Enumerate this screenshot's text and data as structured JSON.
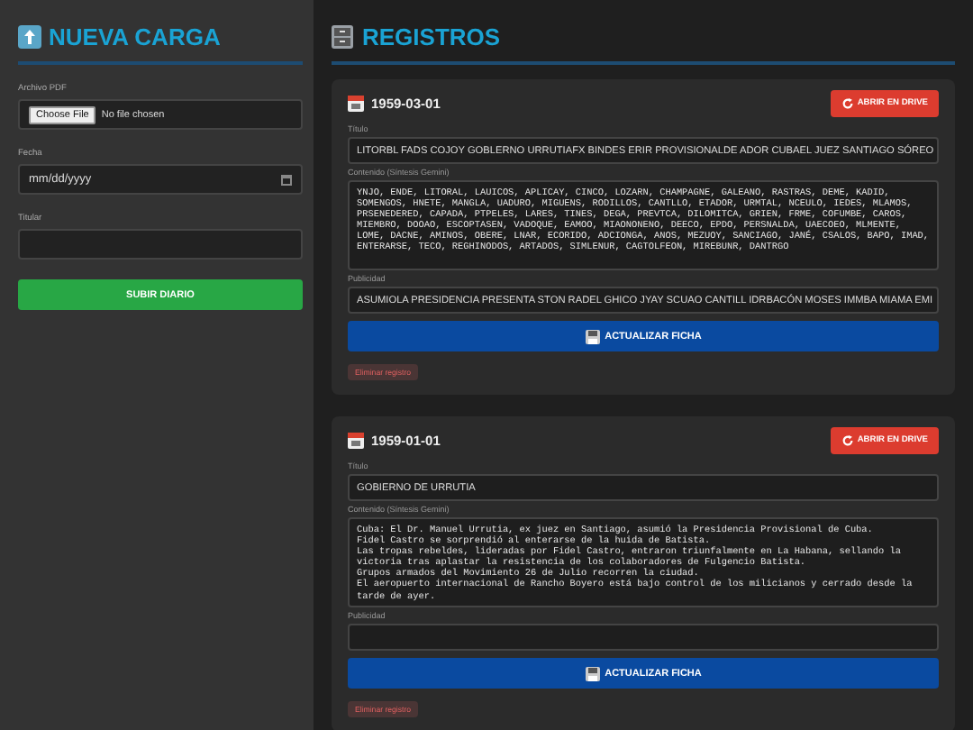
{
  "sidebar": {
    "title": "NUEVA CARGA",
    "fields": [
      {
        "kind": "file",
        "label": "Archivo PDF",
        "button": "Choose File",
        "value": "No file chosen"
      },
      {
        "kind": "date",
        "label": "Fecha",
        "placeholder": "mm/dd/yyyy"
      },
      {
        "kind": "text",
        "label": "Titular"
      }
    ],
    "submit": "SUBIR DIARIO"
  },
  "main": {
    "title": "REGISTROS"
  },
  "records": [
    {
      "date": "1959-03-01",
      "open_button": "ABRIR EN DRIVE",
      "title_label": "Título",
      "title_value": "LITORBL FADS COJOY GOBLERNO URRUTIAFX BINDES ERIR PROVISIONALDE ADOR CUBAEL JUEZ SANTIAGO SÓREO",
      "content_label": "Contenido (Síntesis Gemini)",
      "content": "YNJO, ENDE, LITORAL, LAUICOS, APLICAY, CINCO, LOZARN, CHAMPAGNE, GALEANO, RASTRAS, DEME, KADID, SOMENGOS, HNETE, MANGLA, UADURO, MIGUENS, RODILLOS, CANTLLO, ETADOR, URMTAL, NCEULO, IEDES, MLAMOS, PRSENEDERED, CAPADA, PTPELES, LARES, TINES, DEGA, PREVTCA, DILOMITCA, GRIEN, FRME, COFUMBE, CAROS, MIEMBRO, DOOAO, ESCOPTASEN, VADOQUE, EAMOO, MIAONONENO, DEECO, EPDO, PERSNALDA, UAECOEO, MLMENTE, LOME, DACNE, AMINOS, OBERE, LNAR, ECORIDO, ADCIONGA, ANOS, MEZUOY, SANCIAGO, JANÉ, CSALOS, BAPO, IMAD, ENTERARSE, TECO, REGHINODOS, ARTADOS, SIMLENUR, CAGTOLFEON, MIREBUNR, DANTRGO",
      "ads_label": "Publicidad",
      "ads_value": "ASUMIOLA PRESIDENCIA PRESENTA STON RADEL GHICO JYAY SCUAO CANTILL IDRBACÓN MOSES IMMBA MIAMA EMI",
      "update_button": "ACTUALIZAR FICHA",
      "delete_button": "Eliminar registro"
    },
    {
      "date": "1959-01-01",
      "open_button": "ABRIR EN DRIVE",
      "title_label": "Título",
      "title_value": "GOBIERNO DE URRUTIA",
      "content_label": "Contenido (Síntesis Gemini)",
      "content": "Cuba: El Dr. Manuel Urrutia, ex juez en Santiago, asumió la Presidencia Provisional de Cuba.\nFidel Castro se sorprendió al enterarse de la huida de Batista.\nLas tropas rebeldes, lideradas por Fidel Castro, entraron triunfalmente en La Habana, sellando la victoria tras aplastar la resistencia de los colaboradores de Fulgencio Batista.\nGrupos armados del Movimiento 26 de Julio recorren la ciudad.\nEl aeropuerto internacional de Rancho Boyero está bajo control de los milicianos y cerrado desde la tarde de ayer.",
      "ads_label": "Publicidad",
      "update_button": "ACTUALIZAR FICHA",
      "delete_button": "Eliminar registro"
    }
  ]
}
